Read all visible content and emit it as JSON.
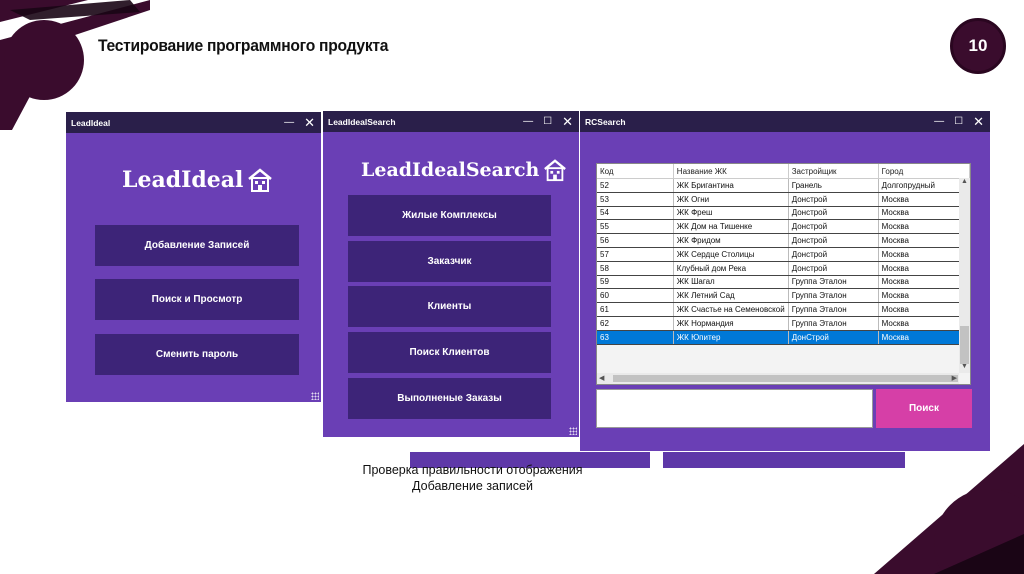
{
  "slide": {
    "title": "Тестирование программного продукта",
    "page_number": "10",
    "caption_line1": "Проверка правильности отображения",
    "caption_line2": "Добавление записей"
  },
  "colors": {
    "window_bg": "#6a3fb5",
    "titlebar": "#2a1f4a",
    "button": "#3d2478",
    "search_button": "#d63fa7",
    "selected_row": "#0078d7",
    "accent_dark": "#3a0c2d"
  },
  "window1": {
    "title": "LeadIdeal",
    "logo_text": "LeadIdeal",
    "logo_icon": "house-icon",
    "buttons": [
      "Добавление Записей",
      "Поиск и Просмотр",
      "Сменить пароль"
    ]
  },
  "window2": {
    "title": "LeadIdealSearch",
    "logo_text": "LeadIdealSearch",
    "logo_icon": "house-icon",
    "buttons": [
      "Жилые Комплексы",
      "Заказчик",
      "Клиенты",
      "Поиск Клиентов",
      "Выполненые Заказы"
    ]
  },
  "window3": {
    "title": "RCSearch",
    "columns": [
      "Код",
      "Название ЖК",
      "Застройщик",
      "Город"
    ],
    "rows": [
      [
        "52",
        "ЖК Бригантина",
        "Гранель",
        "Долгопрудный"
      ],
      [
        "53",
        "ЖК Огни",
        "Донстрой",
        "Москва"
      ],
      [
        "54",
        "ЖК Фреш",
        "Донстрой",
        "Москва"
      ],
      [
        "55",
        "ЖК Дом на Тишенке",
        "Донстрой",
        "Москва"
      ],
      [
        "56",
        "ЖК Фридом",
        "Донстрой",
        "Москва"
      ],
      [
        "57",
        "ЖК Сердце Столицы",
        "Донстрой",
        "Москва"
      ],
      [
        "58",
        "Клубный дом Река",
        "Донстрой",
        "Москва"
      ],
      [
        "59",
        "ЖК Шагал",
        "Группа Эталон",
        "Москва"
      ],
      [
        "60",
        "ЖК Летний Сад",
        "Группа Эталон",
        "Москва"
      ],
      [
        "61",
        "ЖК Счастье на Семеновской",
        "Группа Эталон",
        "Москва"
      ],
      [
        "62",
        "ЖК Нормандия",
        "Группа Эталон",
        "Москва"
      ],
      [
        "63",
        "ЖК Юпитер",
        "ДонСтрой",
        "Москва"
      ]
    ],
    "search_value": "",
    "search_button_label": "Поиск"
  }
}
